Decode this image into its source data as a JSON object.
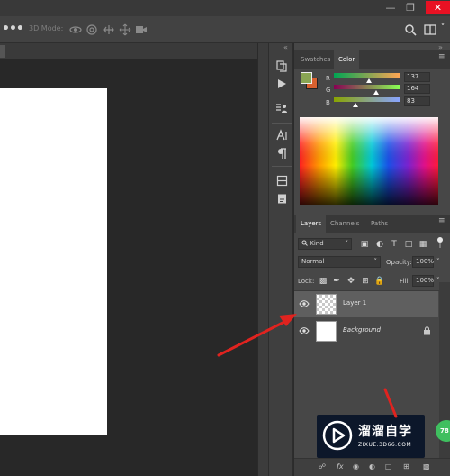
{
  "window": {
    "minimize_icon": "minimize-icon",
    "maximize_icon": "restore-icon",
    "close_icon": "close-icon"
  },
  "options_bar": {
    "more_label": "•••",
    "mode_3d_label": "3D Mode:",
    "icons": [
      "orbit-3d-icon",
      "roll-3d-icon",
      "drag-3d-icon",
      "slide-3d-icon",
      "scale-3d-video-icon"
    ],
    "search_icon": "search-icon",
    "workspace_icon": "workspace-icon"
  },
  "swatches_color_panel": {
    "tabs": [
      {
        "label": "Swatches",
        "active": false
      },
      {
        "label": "Color",
        "active": true
      }
    ],
    "foreground_color": "#89a553",
    "background_color": "#d8612f",
    "channels": [
      {
        "label": "R",
        "value": "137",
        "fraction": 0.537
      },
      {
        "label": "G",
        "value": "164",
        "fraction": 0.643
      },
      {
        "label": "B",
        "value": "83",
        "fraction": 0.325
      }
    ]
  },
  "layers_panel": {
    "tabs": [
      {
        "label": "Layers",
        "active": true
      },
      {
        "label": "Channels",
        "active": false
      },
      {
        "label": "Paths",
        "active": false
      }
    ],
    "filter_kind": "Kind",
    "blend_mode": "Normal",
    "opacity_label": "Opacity:",
    "opacity_value": "100%",
    "lock_label": "Lock:",
    "fill_label": "Fill:",
    "fill_value": "100%",
    "layers": [
      {
        "name": "Layer 1",
        "selected": true,
        "visible": true
      },
      {
        "name": "Background",
        "selected": false,
        "visible": true,
        "locked": true
      }
    ],
    "bottom_icons": [
      "link-icon",
      "fx-icon",
      "mask-icon",
      "adjustment-icon",
      "group-icon",
      "new-layer-icon",
      "trash-icon"
    ],
    "fx_label": "fx"
  },
  "watermark": {
    "title": "溜溜自学",
    "url": "ZIXUE.3D66.COM"
  },
  "badge": {
    "value": "78"
  },
  "colors": {
    "panel_bg": "#474747",
    "selected_layer": "#5f5f5f",
    "annotation_arrow": "#e0231f"
  }
}
